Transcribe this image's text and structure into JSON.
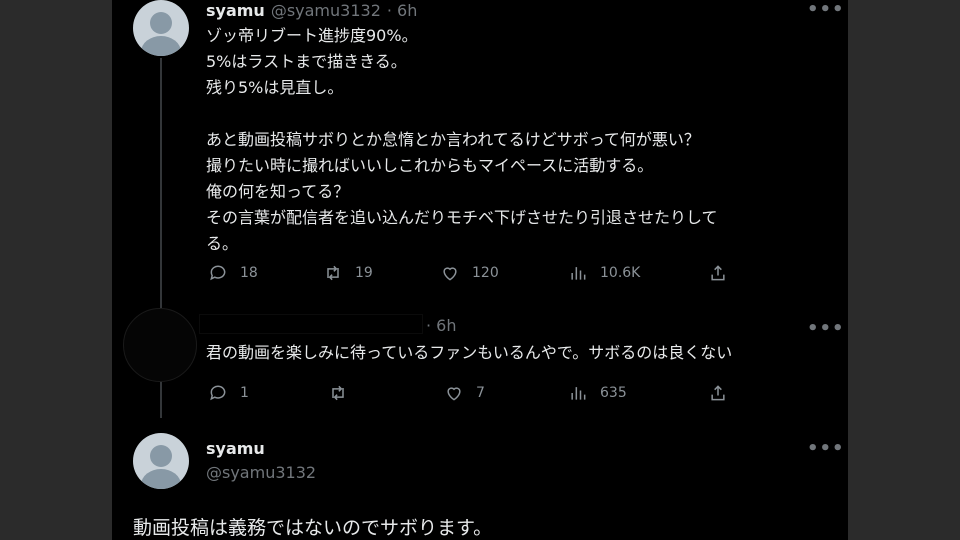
{
  "tweet1": {
    "name": "syamu",
    "handle": "@syamu3132",
    "time": "· 6h",
    "text": "ゾッ帝リブート進捗度90%。\n5%はラストまで描ききる。\n残り5%は見直し。\n\nあと動画投稿サボりとか怠惰とか言われてるけどサボって何が悪い？\n撮りたい時に撮ればいいしこれからもマイペースに活動する。\n俺の何を知ってる？\nその言葉が配信者を追い込んだりモチベ下げさせたり引退させたりして\nる。",
    "replies": "18",
    "retweets": "19",
    "likes": "120",
    "views": "10.6K"
  },
  "reply": {
    "time": "· 6h",
    "text": "君の動画を楽しみに待っているファンもいるんやで。サボるのは良くない",
    "replies": "1",
    "retweets": "",
    "likes": "7",
    "views": "635"
  },
  "tweet2": {
    "name": "syamu",
    "handle": "@syamu3132",
    "text": "動画投稿は義務ではないのでサボります。"
  },
  "icons": {
    "more": "more-horizontal-icon",
    "reply": "speech-bubble-icon",
    "retweet": "retweet-icon",
    "like": "heart-icon",
    "views": "bar-chart-icon",
    "share": "share-upload-icon"
  },
  "colors": {
    "background": "#000000",
    "text": "#e7e9ea",
    "secondary": "#71767b"
  }
}
